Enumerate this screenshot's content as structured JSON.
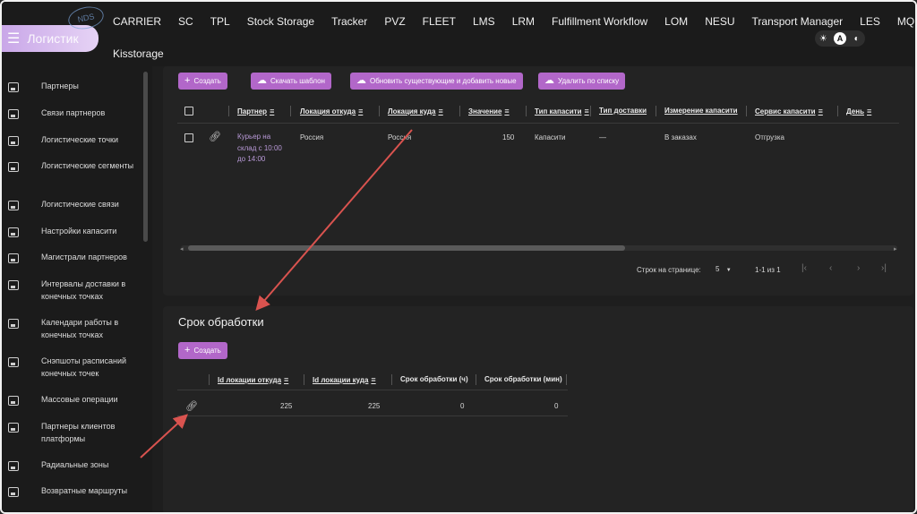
{
  "topnav": {
    "logo_text": "Логистик",
    "logo_badge": "NDS",
    "items": [
      "CARRIER",
      "SC",
      "TPL",
      "Stock Storage",
      "Tracker",
      "PVZ",
      "FLEET",
      "LMS",
      "LRM",
      "Fulfillment Workflow",
      "LOM",
      "NESU",
      "Transport Manager",
      "LES",
      "MQM"
    ],
    "second_row": "Kisstorage",
    "theme": {
      "light_icon": "sun-icon",
      "auto_label": "A",
      "dark_icon": "moon-icon"
    }
  },
  "sidebar": {
    "items": [
      {
        "label": "Партнеры"
      },
      {
        "label": "Связи партнеров"
      },
      {
        "label": "Логистические точки"
      },
      {
        "label": "Логистические сегменты"
      },
      {
        "label": "Логистические связи"
      },
      {
        "label": "Настройки капасити"
      },
      {
        "label": "Магистрали партнеров"
      },
      {
        "label": "Интервалы доставки в конечных точках"
      },
      {
        "label": "Календари работы в конечных точках"
      },
      {
        "label": "Снэпшоты расписаний конечных точек"
      },
      {
        "label": "Массовые операции"
      },
      {
        "label": "Партнеры клиентов платформы"
      },
      {
        "label": "Радиальные зоны"
      },
      {
        "label": "Возвратные маршруты"
      }
    ]
  },
  "capacity": {
    "buttons": {
      "create": "Создать",
      "download_template": "Скачать шаблон",
      "update_existing": "Обновить существующие и добавить новые",
      "delete_by_list": "Удалить по списку"
    },
    "columns": [
      "Партнер",
      "Локация откуда",
      "Локация куда",
      "Значение",
      "Тип капасити",
      "Тип доставки",
      "Измерение капасити",
      "Сервис капасити",
      "День"
    ],
    "rows": [
      {
        "partner": "Курьер на склад с 10:00 до 14:00",
        "from": "Россия",
        "to": "Россия",
        "value": "150",
        "type": "Капасити",
        "delivery_type": "—",
        "measure": "В заказах",
        "service": "Отгрузка",
        "day": ""
      }
    ],
    "pager": {
      "rows_per_page_label": "Строк на странице:",
      "rows_per_page": "5",
      "range": "1-1 из 1"
    }
  },
  "processing": {
    "title": "Срок обработки",
    "create_label": "Создать",
    "columns": [
      "Id локации откуда",
      "Id локации куда",
      "Срок обработки (ч)",
      "Срок обработки (мин)"
    ],
    "rows": [
      {
        "from_id": "225",
        "to_id": "225",
        "hours": "0",
        "minutes": "0"
      }
    ]
  },
  "colors": {
    "accent": "#b267c9",
    "background": "#1e1e1e",
    "card": "#232323",
    "arrow": "#d9534f"
  }
}
